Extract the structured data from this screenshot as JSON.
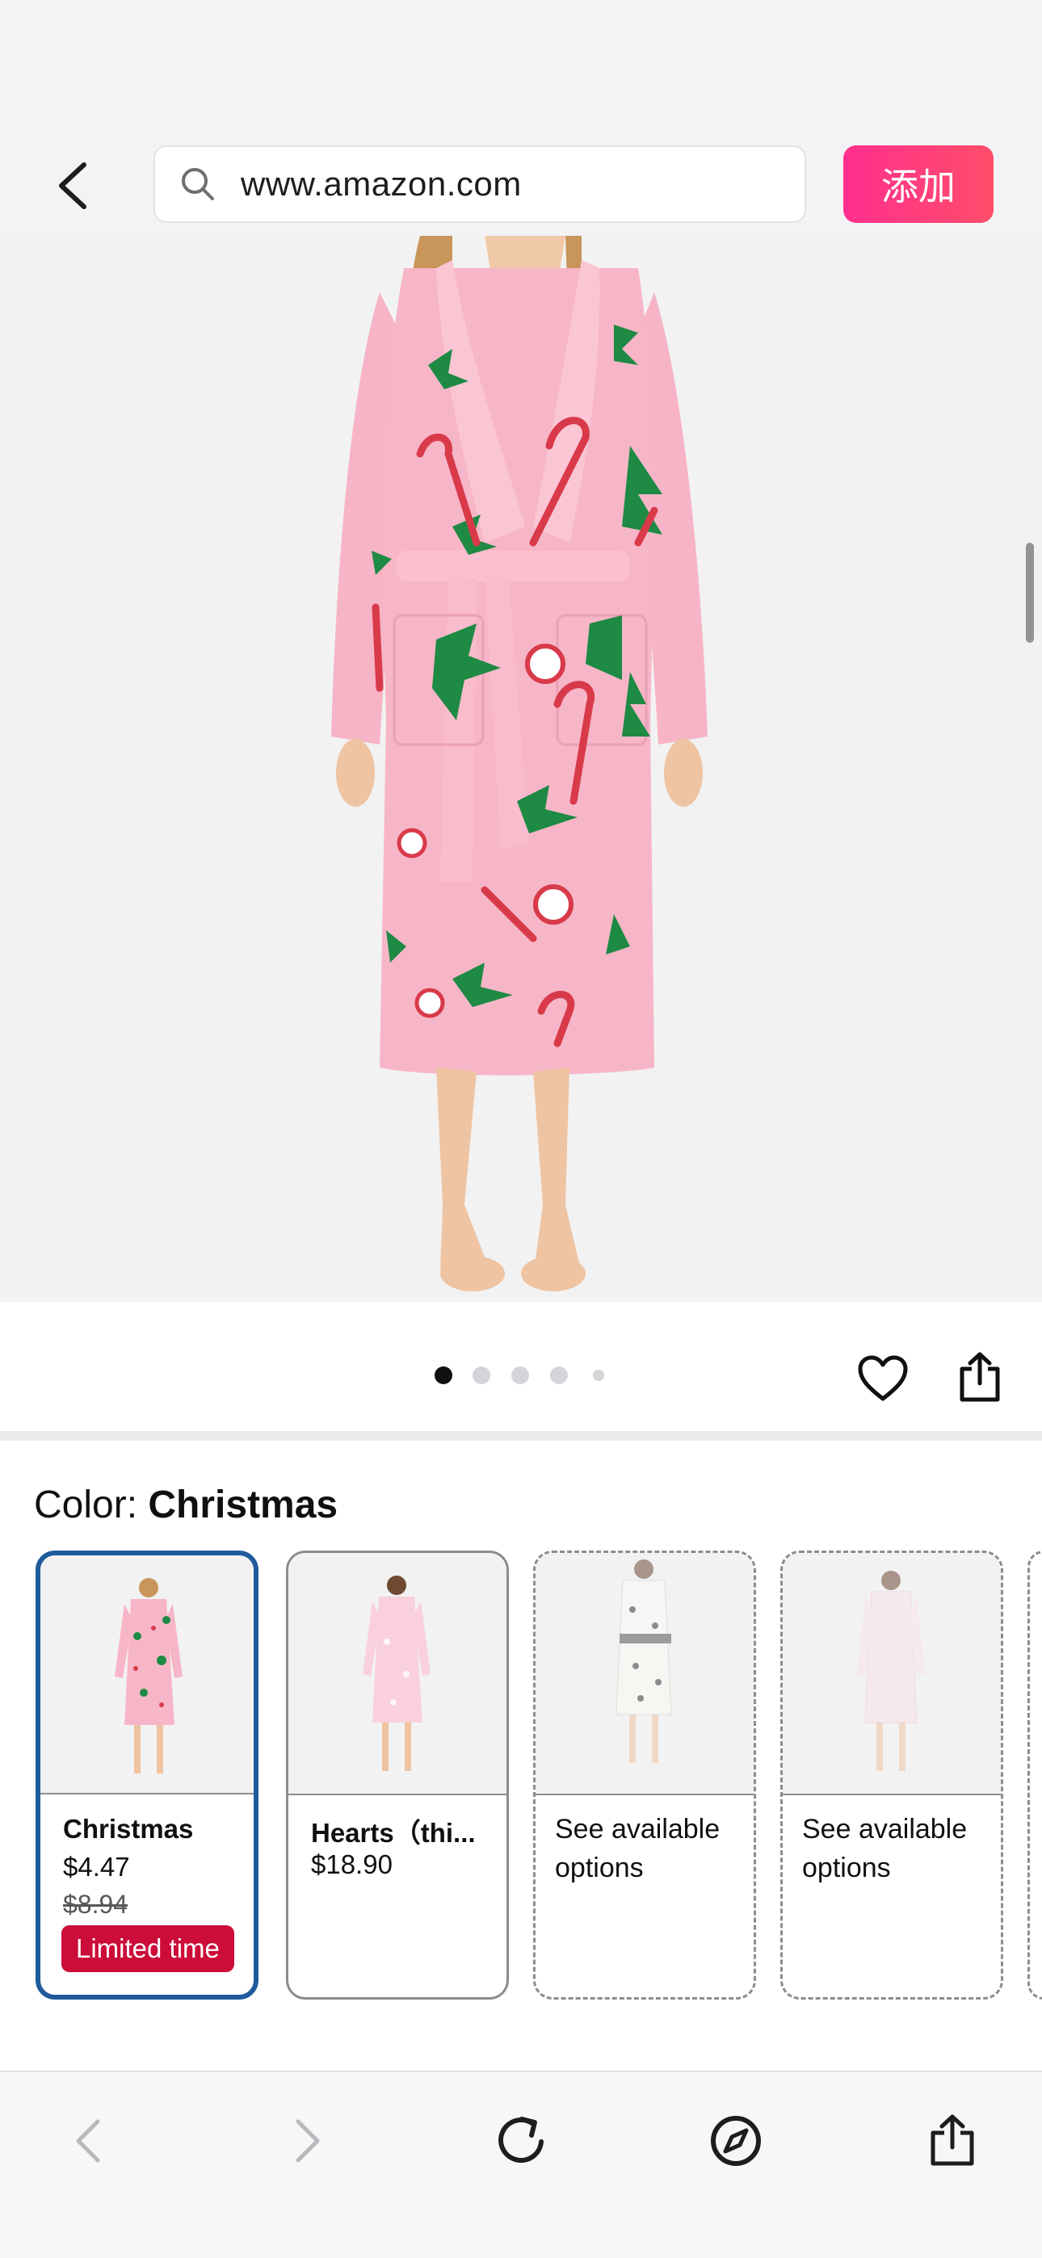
{
  "browser": {
    "url": "www.amazon.com",
    "add_label": "添加",
    "accent_gradient": [
      "#ff2f8e",
      "#ff4d6a"
    ]
  },
  "gallery": {
    "image_count": 5,
    "active_index": 0
  },
  "color_section": {
    "label_prefix": "Color: ",
    "selected_color": "Christmas",
    "options": [
      {
        "name": "Christmas",
        "price": "$4.47",
        "was_price": "$8.94",
        "badge": "Limited time",
        "style": "selected"
      },
      {
        "name": "Hearts（thi...",
        "price": "$18.90",
        "style": "solid"
      },
      {
        "availability": "See available options",
        "style": "dashed"
      },
      {
        "availability": "See available options",
        "style": "dashed"
      }
    ]
  },
  "colors": {
    "selected_border": "#1f5b9c",
    "badge_bg": "#cc0c39",
    "robe_pink": "#f7b6c8",
    "holly_green": "#1e8a44"
  }
}
